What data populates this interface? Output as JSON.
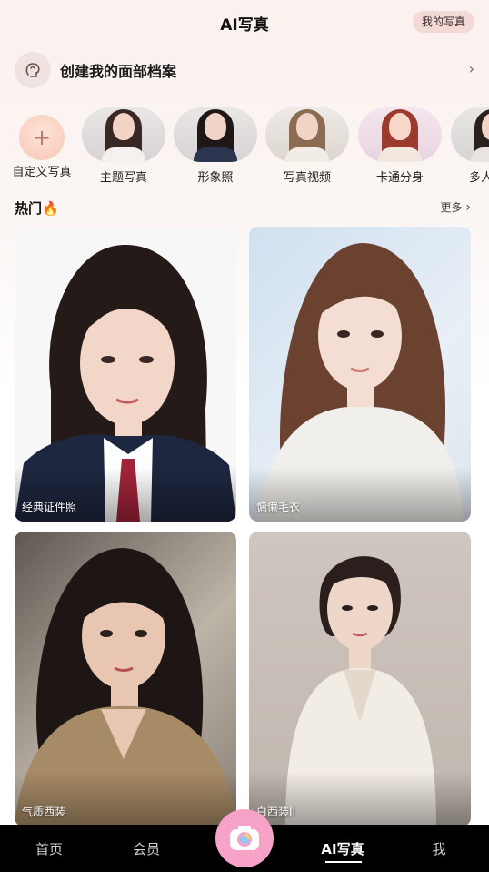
{
  "header": {
    "title": "AI写真",
    "my_photos": "我的写真"
  },
  "face_profile": {
    "label": "创建我的面部档案"
  },
  "categories": [
    {
      "label": "自定义写真"
    },
    {
      "label": "主题写真"
    },
    {
      "label": "形象照"
    },
    {
      "label": "写真视频"
    },
    {
      "label": "卡通分身"
    },
    {
      "label": "多人"
    }
  ],
  "hot": {
    "title": "热门",
    "more": "更多"
  },
  "cards": [
    {
      "caption": "经典证件照"
    },
    {
      "caption": "慵懒毛衣"
    },
    {
      "caption": "气质西装"
    },
    {
      "caption": "白西装II"
    }
  ],
  "nav": {
    "items": [
      "首页",
      "会员",
      "AI写真",
      "我"
    ],
    "active": "AI写真"
  },
  "colors": {
    "accent": "#f7a3c8",
    "badge_bg": "#f3d9d6",
    "nav_bg": "#000000"
  }
}
